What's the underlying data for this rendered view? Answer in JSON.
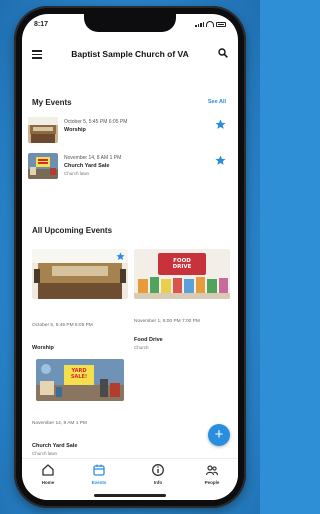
{
  "status_bar": {
    "time": "8:17"
  },
  "header": {
    "title": "Baptist Sample Church of VA"
  },
  "my_events": {
    "title": "My Events",
    "see_all": "See All",
    "items": [
      {
        "date": "October 5, 5:45 PM   6:05 PM",
        "name": "Worship",
        "location": ""
      },
      {
        "date": "November 14, 8 AM   1 PM",
        "name": "Church Yard Sale",
        "location": "Church lawn"
      }
    ]
  },
  "upcoming": {
    "title": "All Upcoming Events",
    "cards": [
      {
        "date": "October 5, 5:45 PM   6:05 PM",
        "name": "Worship",
        "location": ""
      },
      {
        "date": "November 1, 5:00 PM   7:00 PM",
        "name": "Food Drive",
        "location": "Church"
      },
      {
        "date": "November 14, 8 AM   1 PM",
        "name": "Church Yard Sale",
        "location": "Church lawn"
      }
    ],
    "food_drive_sign": "FOOD DRIVE",
    "yard_sale_sign": "YARD SALE!"
  },
  "fab": {
    "label": "+"
  },
  "tabs": [
    {
      "label": "Home",
      "icon": "home-icon"
    },
    {
      "label": "Events",
      "icon": "calendar-icon"
    },
    {
      "label": "Info",
      "icon": "info-icon"
    },
    {
      "label": "People",
      "icon": "people-icon"
    }
  ],
  "colors": {
    "accent": "#2a8ee0",
    "background": "#2f8fd6"
  }
}
